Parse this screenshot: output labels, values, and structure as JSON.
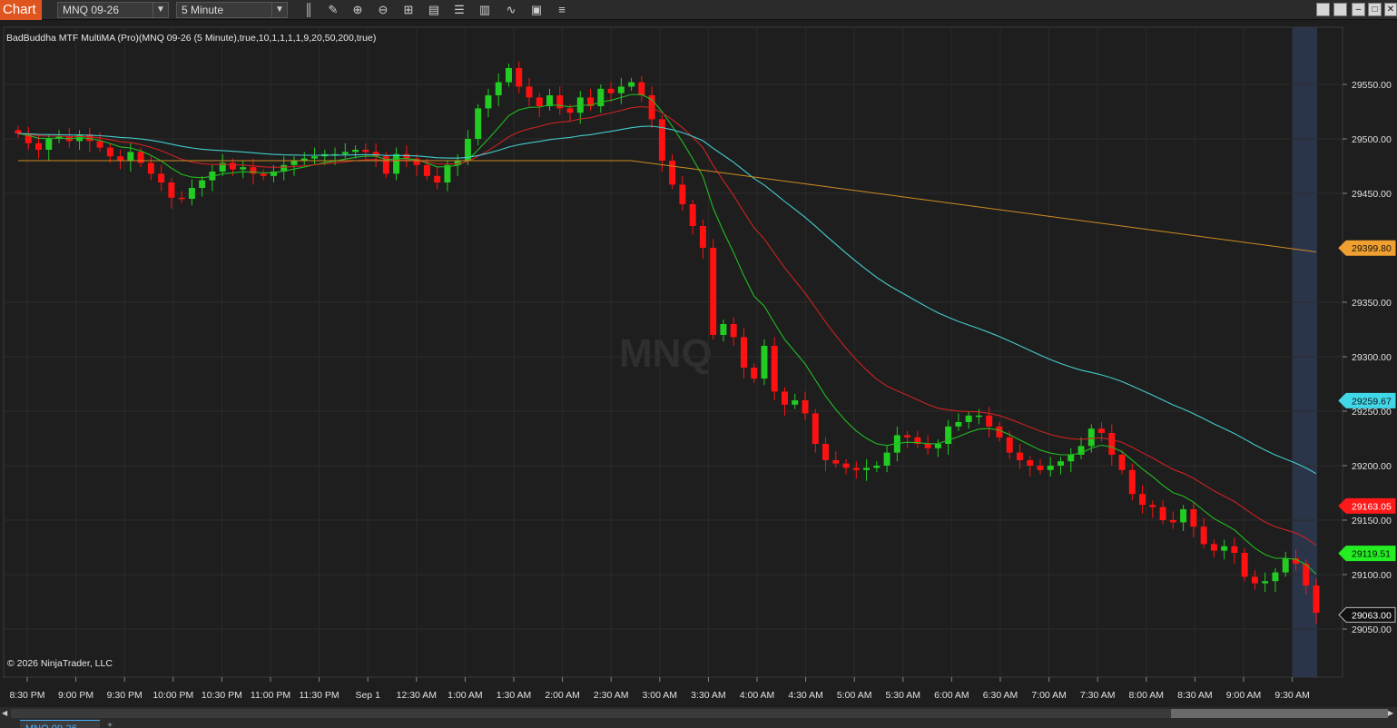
{
  "window": {
    "tab_label": "Chart",
    "instrument": "MNQ 09-26",
    "interval": "5 Minute",
    "controls": [
      "minimize-icon",
      "maximize-icon",
      "close-icon"
    ]
  },
  "toolbar_icons": [
    "bar-type-icon",
    "draw-pencil-icon",
    "zoom-in-icon",
    "zoom-out-icon",
    "crosshair-icon",
    "data-box-icon",
    "properties-icon",
    "chart-style-icon",
    "indicators-icon",
    "strategies-icon",
    "menu-icon"
  ],
  "indicator_label": "BadBuddha MTF MultiMA (Pro)(MNQ 09-26 (5 Minute),true,10,1,1,1,1,9,20,50,200,true)",
  "watermark": "MNQ",
  "copyright": "© 2026 NinjaTrader, LLC",
  "bottom_tab": "MNQ 09-26",
  "add_tab": "+",
  "colors": {
    "background": "#1e1e1e",
    "up_candle": "#22cc22",
    "down_candle": "#ff1111",
    "ma9": "#22bb22",
    "ma20": "#cc2222",
    "ma50": "#44cccc",
    "ma200": "#cc8a22",
    "highlight_session": "#2e3a52"
  },
  "chart_data": {
    "type": "candlestick",
    "symbol": "MNQ 09-26",
    "interval": "5 Minute",
    "x_labels": [
      "8:30 PM",
      "9:00 PM",
      "9:30 PM",
      "10:00 PM",
      "10:30 PM",
      "11:00 PM",
      "11:30 PM",
      "Sep 1",
      "12:30 AM",
      "1:00 AM",
      "1:30 AM",
      "2:00 AM",
      "2:30 AM",
      "3:00 AM",
      "3:30 AM",
      "4:00 AM",
      "4:30 AM",
      "5:00 AM",
      "5:30 AM",
      "6:00 AM",
      "6:30 AM",
      "7:00 AM",
      "7:30 AM",
      "8:00 AM",
      "8:30 AM",
      "9:00 AM",
      "9:30 AM"
    ],
    "y_ticks": [
      "29550.00",
      "29500.00",
      "29450.00",
      "29350.00",
      "29300.00",
      "29250.00",
      "29200.00",
      "29150.00",
      "29100.00",
      "29050.00"
    ],
    "ylim": [
      28990,
      29595
    ],
    "closes": [
      29505,
      29496,
      29490,
      29500,
      29502,
      29498,
      29504,
      29498,
      29492,
      29484,
      29480,
      29488,
      29478,
      29468,
      29460,
      29446,
      29445,
      29455,
      29462,
      29470,
      29478,
      29472,
      29474,
      29468,
      29466,
      29470,
      29476,
      29480,
      29482,
      29484,
      29486,
      29486,
      29488,
      29490,
      29488,
      29484,
      29468,
      29486,
      29482,
      29476,
      29466,
      29460,
      29476,
      29480,
      29500,
      29528,
      29540,
      29552,
      29565,
      29548,
      29538,
      29530,
      29540,
      29528,
      29524,
      29538,
      29530,
      29546,
      29542,
      29548,
      29552,
      29540,
      29518,
      29480,
      29458,
      29440,
      29420,
      29400,
      29320,
      29330,
      29318,
      29290,
      29280,
      29310,
      29268,
      29256,
      29260,
      29248,
      29220,
      29205,
      29202,
      29198,
      29196,
      29198,
      29200,
      29212,
      29228,
      29226,
      29220,
      29216,
      29220,
      29236,
      29240,
      29246,
      29246,
      29236,
      29226,
      29212,
      29205,
      29200,
      29196,
      29200,
      29204,
      29210,
      29218,
      29234,
      29230,
      29210,
      29196,
      29174,
      29164,
      29162,
      29150,
      29148,
      29160,
      29144,
      29128,
      29122,
      29126,
      29120,
      29098,
      29092,
      29094,
      29102,
      29115,
      29110,
      29090,
      29065
    ],
    "price_tags": [
      "29399.80",
      "29259.67",
      "29163.05",
      "29119.51",
      "29063.00"
    ],
    "series": [
      {
        "name": "MA 9",
        "color": "#22bb22"
      },
      {
        "name": "MA 20",
        "color": "#cc2222"
      },
      {
        "name": "MA 50",
        "color": "#44cccc"
      },
      {
        "name": "MA 200",
        "color": "#cc8a22"
      }
    ],
    "grid": true,
    "highlighted_bar": "9:30 AM"
  }
}
